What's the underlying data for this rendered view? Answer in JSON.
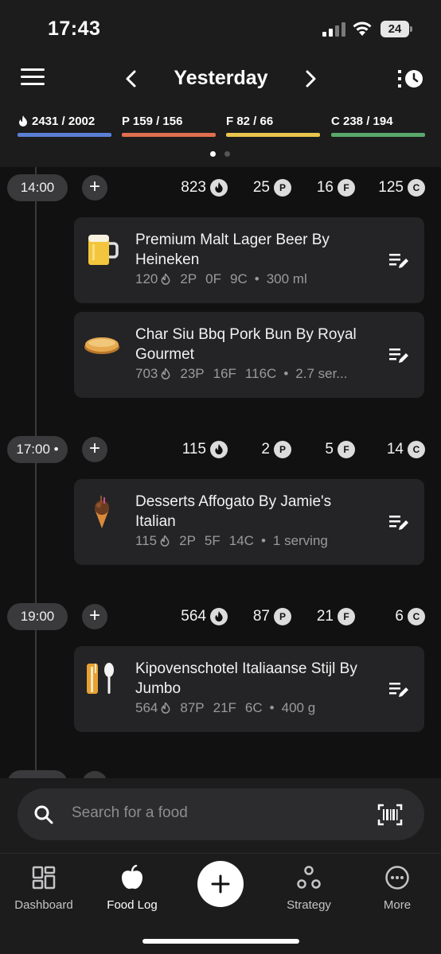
{
  "status_bar": {
    "time": "17:43",
    "battery": "24"
  },
  "header": {
    "title": "Yesterday"
  },
  "macros": [
    {
      "label": "2431 / 2002",
      "prefix": "",
      "color": "#5b7fd6",
      "has_flame": true
    },
    {
      "label": "P 159 / 156",
      "color": "#e06e4f",
      "has_flame": false
    },
    {
      "label": "F 82 / 66",
      "color": "#e9c54e",
      "has_flame": false
    },
    {
      "label": "C 238 / 194",
      "color": "#59a86a",
      "has_flame": false
    }
  ],
  "meal_groups": [
    {
      "time": "14:00",
      "totals": {
        "kcal": "823",
        "protein": "25",
        "fat": "16",
        "carbs": "125"
      },
      "entries": [
        {
          "name": "Premium Malt Lager Beer By Heineken",
          "icon": "beer-icon",
          "kcal": "120",
          "protein": "2P",
          "fat": "0F",
          "carbs": "9C",
          "serving": "300 ml"
        },
        {
          "name": "Char Siu Bbq Pork Bun By Royal Gourmet",
          "icon": "bun-icon",
          "kcal": "703",
          "protein": "23P",
          "fat": "16F",
          "carbs": "116C",
          "serving": "2.7 ser..."
        }
      ]
    },
    {
      "time": "17:00 •",
      "totals": {
        "kcal": "115",
        "protein": "2",
        "fat": "5",
        "carbs": "14"
      },
      "entries": [
        {
          "name": "Desserts Affogato By Jamie's Italian",
          "icon": "ice-cream-icon",
          "kcal": "115",
          "protein": "2P",
          "fat": "5F",
          "carbs": "14C",
          "serving": "1 serving"
        }
      ]
    },
    {
      "time": "19:00",
      "totals": {
        "kcal": "564",
        "protein": "87",
        "fat": "21",
        "carbs": "6"
      },
      "entries": [
        {
          "name": "Kipovenschotel Italiaanse Stijl By Jumbo",
          "icon": "cutlery-icon",
          "kcal": "564",
          "protein": "87P",
          "fat": "21F",
          "carbs": "6C",
          "serving": "400 g"
        }
      ]
    }
  ],
  "badges": {
    "protein": "P",
    "fat": "F",
    "carbs": "C"
  },
  "search": {
    "placeholder": "Search for a food"
  },
  "nav": [
    {
      "label": "Dashboard",
      "icon": "dashboard-icon"
    },
    {
      "label": "Food Log",
      "icon": "apple-icon"
    },
    {
      "label": "Strategy",
      "icon": "strategy-icon"
    },
    {
      "label": "More",
      "icon": "more-icon"
    }
  ],
  "colors": {
    "background": "#111111",
    "surface": "#1c1c1d",
    "card": "#242426",
    "accent": "#ffffff"
  }
}
